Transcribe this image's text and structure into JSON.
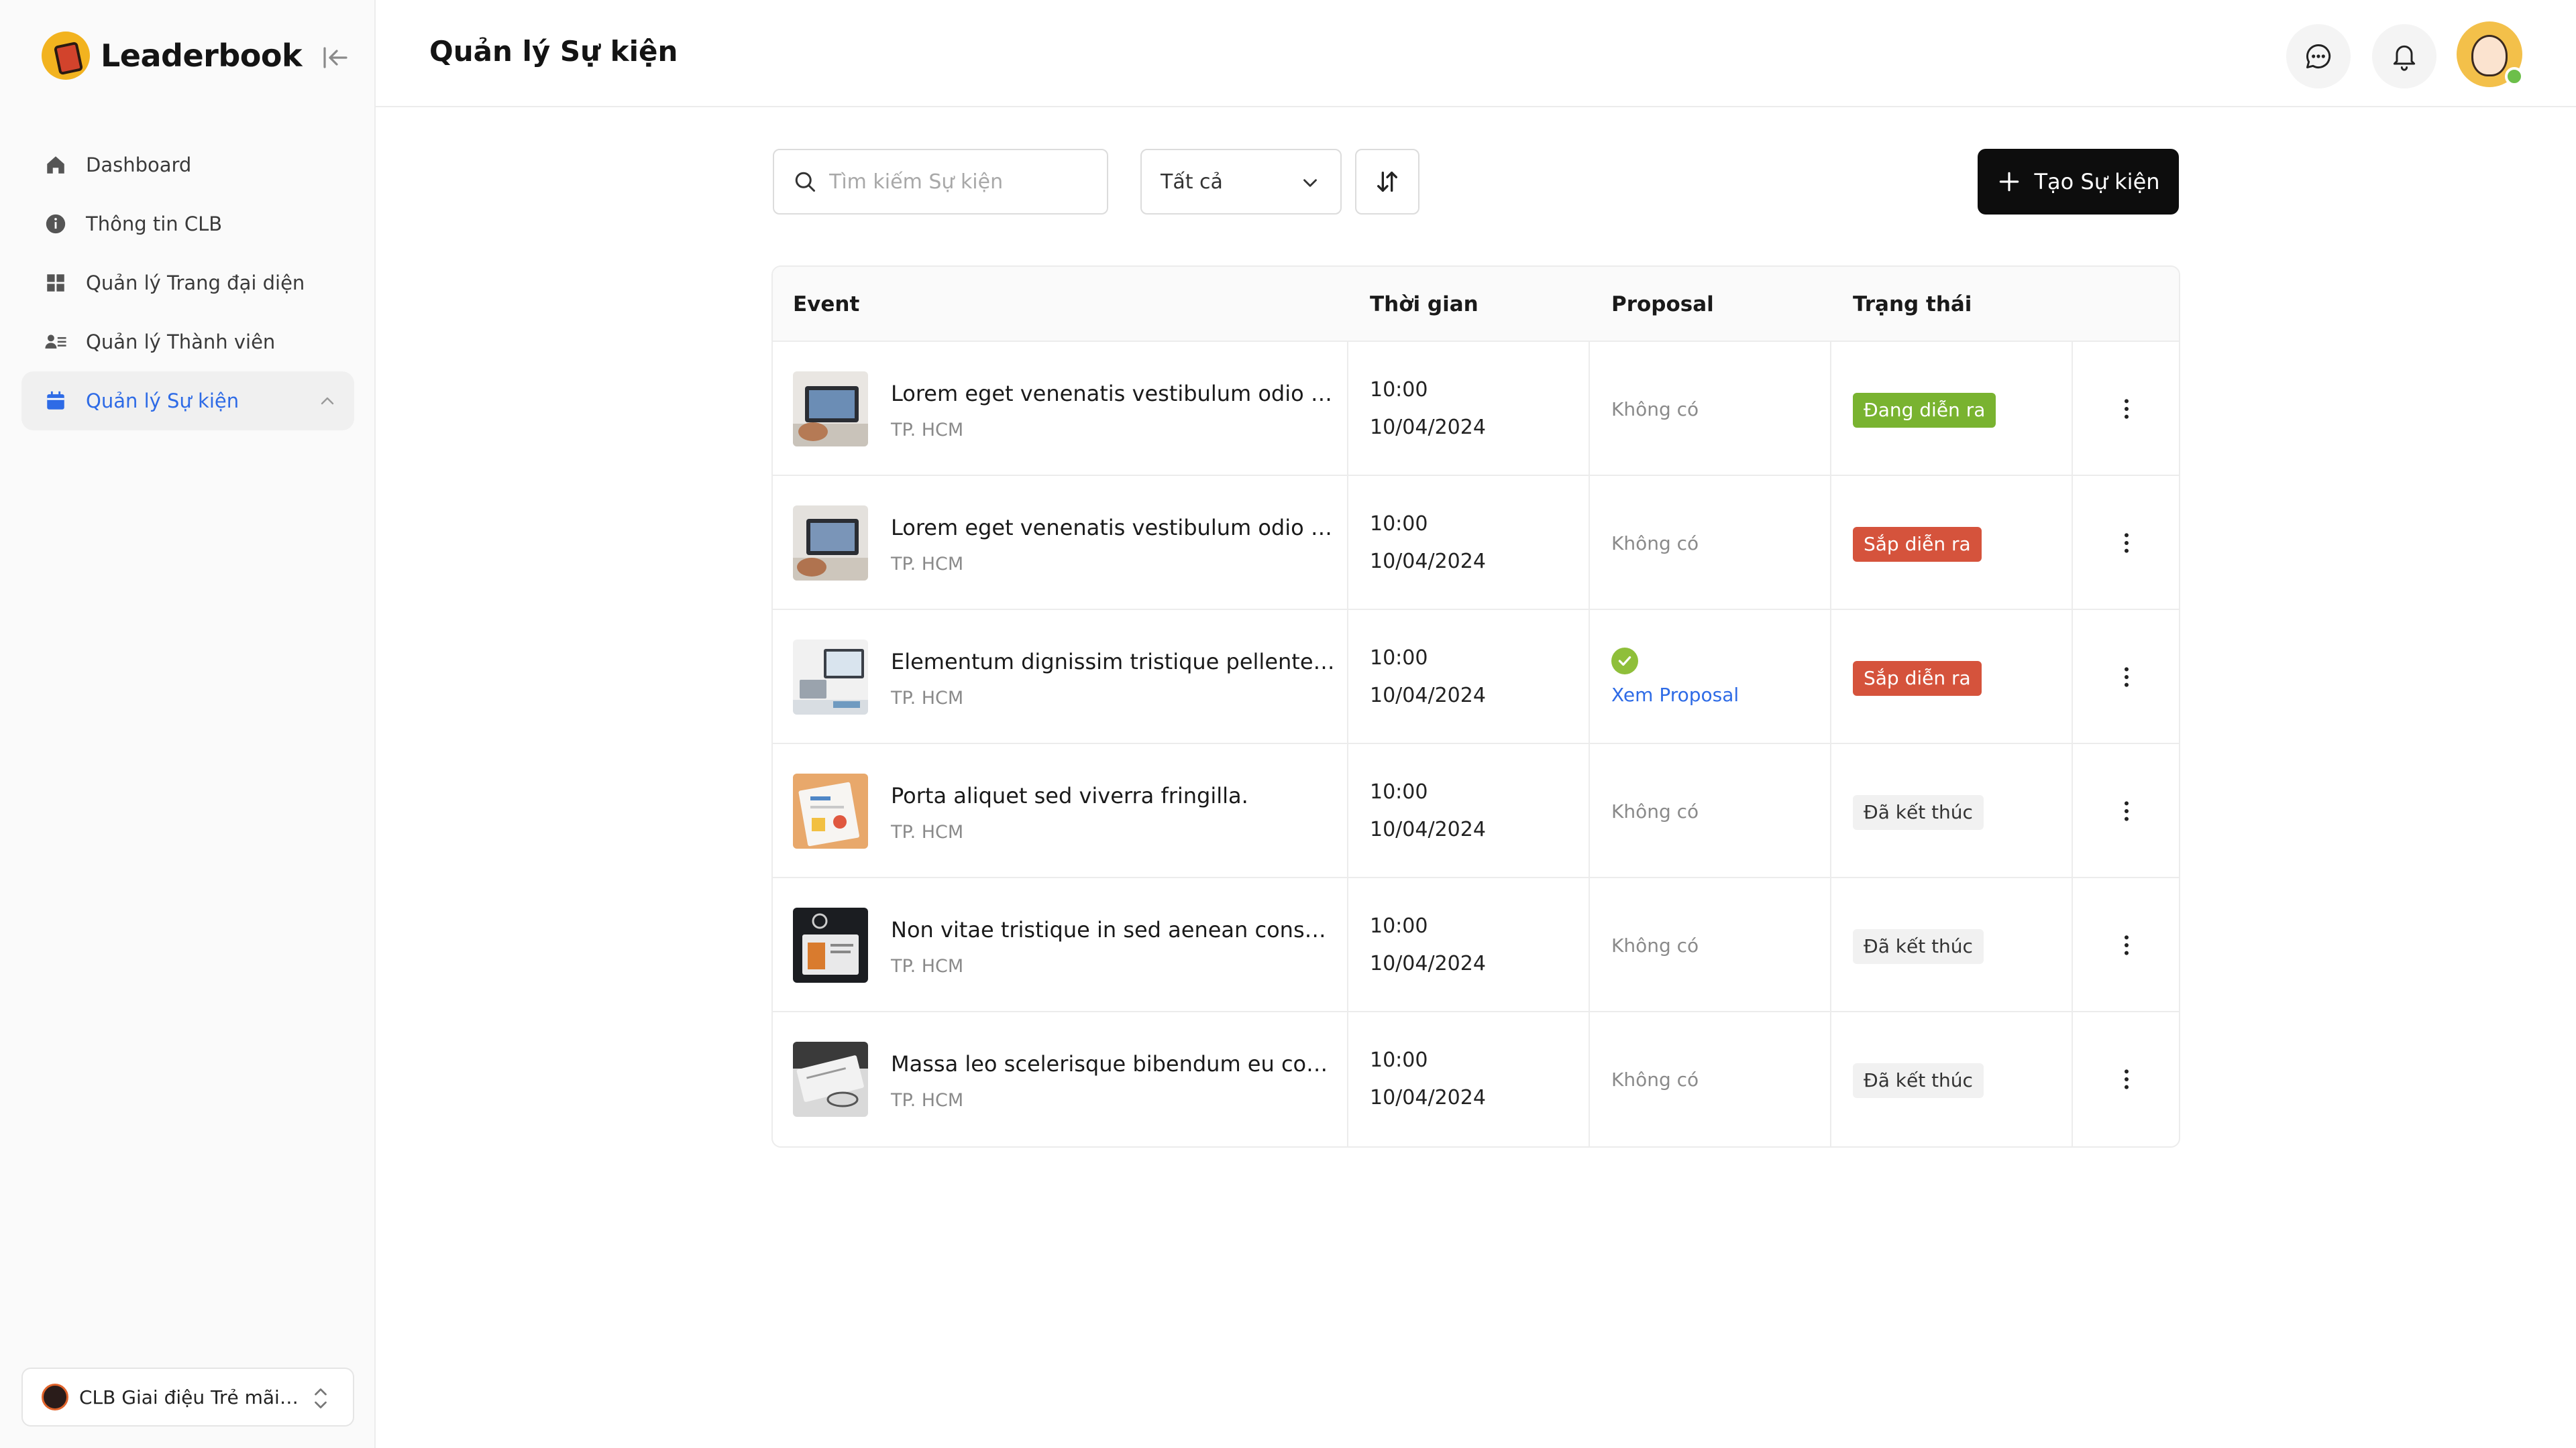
{
  "app": {
    "name": "Leaderbook"
  },
  "sidebar": {
    "items": [
      {
        "label": "Dashboard",
        "icon": "home-icon"
      },
      {
        "label": "Thông tin CLB",
        "icon": "info-icon"
      },
      {
        "label": "Quản lý Trang đại diện",
        "icon": "grid-icon"
      },
      {
        "label": "Quản lý Thành viên",
        "icon": "members-icon"
      },
      {
        "label": "Quản lý Sự kiện",
        "icon": "calendar-icon",
        "active": true
      }
    ],
    "club": {
      "name": "CLB Giai điệu Trẻ mãi k..."
    }
  },
  "header": {
    "title": "Quản lý Sự kiện"
  },
  "toolbar": {
    "search_placeholder": "Tìm kiếm Sự kiện",
    "filter_value": "Tất cả",
    "create_label": "Tạo Sự kiện"
  },
  "table": {
    "columns": [
      "Event",
      "Thời gian",
      "Proposal",
      "Trạng thái"
    ],
    "rows": [
      {
        "name": "Lorem eget venenatis vestibulum odio eget",
        "location": "TP. HCM",
        "time": "10:00",
        "date": "10/04/2024",
        "proposal": "Không có",
        "status": "Đang diễn ra",
        "status_type": "ongoing"
      },
      {
        "name": "Lorem eget venenatis vestibulum odio eget",
        "location": "TP. HCM",
        "time": "10:00",
        "date": "10/04/2024",
        "proposal": "Không có",
        "status": "Sắp diễn ra",
        "status_type": "upcoming"
      },
      {
        "name": "Elementum dignissim tristique pellentesque",
        "location": "TP. HCM",
        "time": "10:00",
        "date": "10/04/2024",
        "proposal": "Xem Proposal",
        "status": "Sắp diễn ra",
        "status_type": "upcoming"
      },
      {
        "name": "Porta aliquet sed viverra fringilla.",
        "location": "TP. HCM",
        "time": "10:00",
        "date": "10/04/2024",
        "proposal": "Không có",
        "status": "Đã kết thúc",
        "status_type": "ended"
      },
      {
        "name": "Non vitae tristique in sed aenean consectetur",
        "location": "TP. HCM",
        "time": "10:00",
        "date": "10/04/2024",
        "proposal": "Không có",
        "status": "Đã kết thúc",
        "status_type": "ended"
      },
      {
        "name": "Massa leo scelerisque bibendum eu commodo",
        "location": "TP. HCM",
        "time": "10:00",
        "date": "10/04/2024",
        "proposal": "Không có",
        "status": "Đã kết thúc",
        "status_type": "ended"
      }
    ]
  },
  "colors": {
    "accent": "#2e6be6",
    "ongoing": "#79b330",
    "upcoming": "#d5533c",
    "primary_button": "#0d0d0d"
  }
}
